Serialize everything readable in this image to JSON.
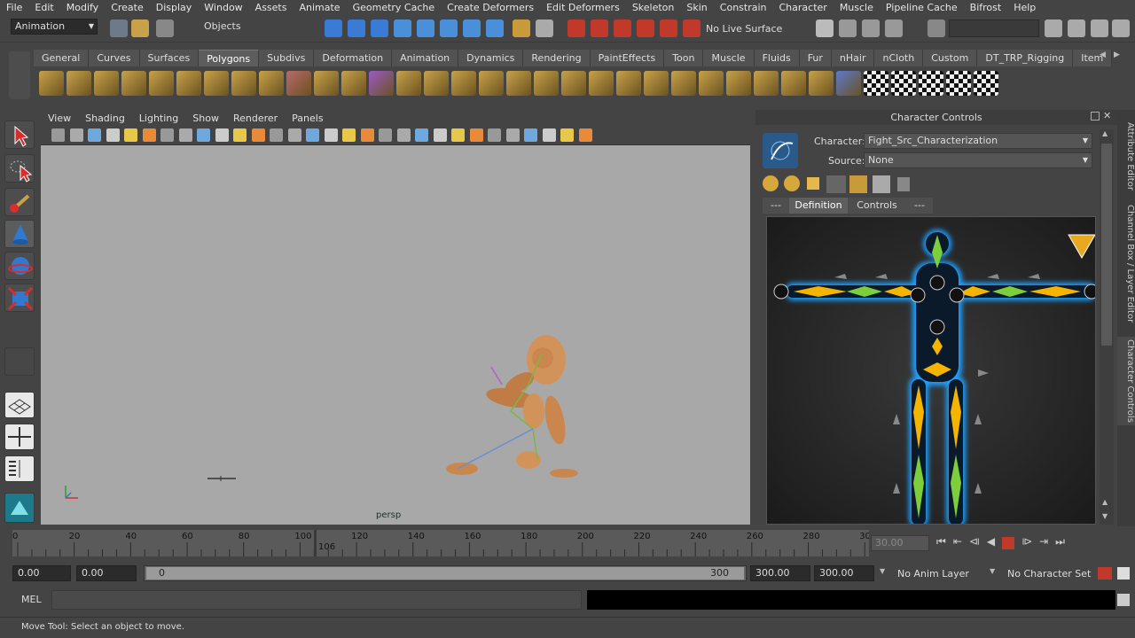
{
  "menubar": [
    "File",
    "Edit",
    "Modify",
    "Create",
    "Display",
    "Window",
    "Assets",
    "Animate",
    "Geometry Cache",
    "Create Deformers",
    "Edit Deformers",
    "Skeleton",
    "Skin",
    "Constrain",
    "Character",
    "Muscle",
    "Pipeline Cache",
    "Bifrost",
    "Help"
  ],
  "statusline": {
    "menuset": "Animation",
    "selection_mode": "Objects",
    "live_surface": "No Live Surface"
  },
  "shelf_tabs": [
    "General",
    "Curves",
    "Surfaces",
    "Polygons",
    "Subdivs",
    "Deformation",
    "Animation",
    "Dynamics",
    "Rendering",
    "PaintEffects",
    "Toon",
    "Muscle",
    "Fluids",
    "Fur",
    "nHair",
    "nCloth",
    "Custom",
    "DT_TRP_Rigging",
    "Item"
  ],
  "shelf_active": "Polygons",
  "viewport": {
    "menus": [
      "View",
      "Shading",
      "Lighting",
      "Show",
      "Renderer",
      "Panels"
    ],
    "camera_label": "persp"
  },
  "character_controls": {
    "title": "Character Controls",
    "character_label": "Character:",
    "character_value": "Fight_Src_Characterization",
    "source_label": "Source:",
    "source_value": "None",
    "tabs": [
      "---",
      "Definition",
      "Controls",
      "---"
    ],
    "active_tab": "Definition"
  },
  "side_tabs": [
    "Attribute Editor",
    "Channel Box / Layer Editor",
    "Character Controls"
  ],
  "timeline": {
    "ticks": [
      "0",
      "20",
      "40",
      "60",
      "80",
      "100",
      "120",
      "140",
      "160",
      "180",
      "200",
      "220",
      "240",
      "260",
      "280",
      "30"
    ],
    "current_frame": "106",
    "current_frame_field": "30.00"
  },
  "range": {
    "start_time": "0.00",
    "playback_start": "0.00",
    "slider_start": "0",
    "slider_end": "300",
    "playback_end": "300.00",
    "end_time": "300.00",
    "anim_layer": "No Anim Layer",
    "character_set": "No Character Set"
  },
  "cmdline": {
    "lang": "MEL"
  },
  "helpline": "Move Tool: Select an object to move.",
  "colors": {
    "panel": "#444444",
    "viewport_bg": "#a8a8a8",
    "hik_green": "#7ccf3a",
    "hik_yellow": "#f4b400",
    "hik_blue_glow": "#1ea0ff",
    "playback_stop": "#c0392b"
  }
}
